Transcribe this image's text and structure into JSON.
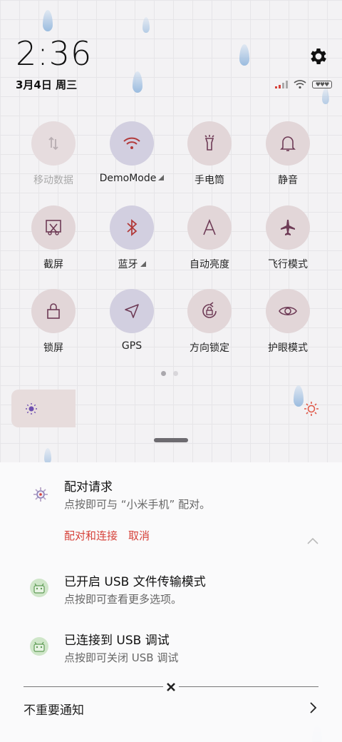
{
  "status": {
    "time": "2:36",
    "date": "3月4日 周三",
    "battery_label": "♥♥♥",
    "icons": [
      "signal-icon",
      "wifi-icon",
      "battery-icon",
      "gear-icon"
    ]
  },
  "tiles": [
    {
      "label": "移动数据",
      "icon": "mobile-data-icon",
      "enabled": false
    },
    {
      "label": "DemoMode",
      "icon": "wifi-icon",
      "enabled": true,
      "has_menu": true
    },
    {
      "label": "手电筒",
      "icon": "flashlight-icon",
      "enabled": false
    },
    {
      "label": "静音",
      "icon": "bell-icon",
      "enabled": false
    },
    {
      "label": "截屏",
      "icon": "screenshot-icon",
      "enabled": false
    },
    {
      "label": "蓝牙",
      "icon": "bluetooth-icon",
      "enabled": true,
      "has_menu": true
    },
    {
      "label": "自动亮度",
      "icon": "auto-brightness-icon",
      "enabled": false
    },
    {
      "label": "飞行模式",
      "icon": "airplane-icon",
      "enabled": false
    },
    {
      "label": "锁屏",
      "icon": "lock-icon",
      "enabled": false
    },
    {
      "label": "GPS",
      "icon": "location-arrow-icon",
      "enabled": true
    },
    {
      "label": "方向锁定",
      "icon": "rotation-lock-icon",
      "enabled": false
    },
    {
      "label": "护眼模式",
      "icon": "eye-icon",
      "enabled": false
    }
  ],
  "pager": {
    "count": 2,
    "active": 0
  },
  "brightness": {
    "level": 0.2
  },
  "notifications": [
    {
      "icon": "pairing-icon",
      "title": "配对请求",
      "body": "点按即可与 “小米手机” 配对。",
      "actions": [
        "配对和连接",
        "取消"
      ]
    },
    {
      "icon": "android-icon",
      "title": "已开启 USB 文件传输模式",
      "body": "点按即可查看更多选项。"
    },
    {
      "icon": "android-icon",
      "title": "已连接到 USB 调试",
      "body": "点按即可关闭 USB 调试"
    }
  ],
  "footer": {
    "unimportant_label": "不重要通知"
  },
  "colors": {
    "accent": "#d6423a",
    "tile_icon": "#6e3b56",
    "tile_active_bg": "#d2cfe0",
    "tile_bg": "#e2d6d8"
  }
}
